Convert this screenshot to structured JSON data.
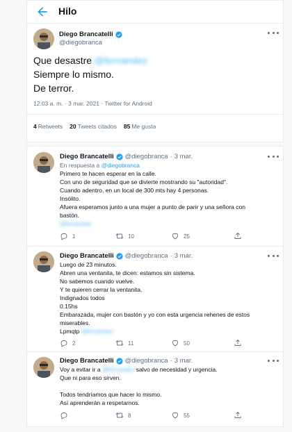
{
  "header": {
    "title": "Hilo"
  },
  "main_tweet": {
    "author_name": "Diego Brancatelli",
    "author_handle": "@diegobranca",
    "line1_prefix": "Que desastre",
    "line1_blurred": "@fernandez",
    "line2": "Siempre lo mismo.",
    "line3": "De terror.",
    "meta": "12:03 a. m. · 3 mar. 2021 · Twitter for Android",
    "stats": {
      "retweets_count": "4",
      "retweets_label": "Retweets",
      "quotes_count": "20",
      "quotes_label": "Tweets citados",
      "likes_count": "85",
      "likes_label": "Me gusta"
    }
  },
  "replies": [
    {
      "author_name": "Diego Brancatelli",
      "author_handle": "@diegobranca",
      "date": "3 mar.",
      "reply_prefix": "En respuesta a",
      "reply_mention": "@diegobranca",
      "lines": [
        "Primero te hacen esperar en la calle.",
        "Con uno de seguridad que se divierte mostrando su \"autoridad\".",
        "Cuando adentro, en un local de 300 mts hay 4 personas.",
        "Insólito.",
        "Afuera esperamos junto a una mujer a punto de parir y una señora con",
        "bastón."
      ],
      "blurred_tail": "@fernandez",
      "replies_count": "1",
      "retweets_count": "10",
      "likes_count": "25"
    },
    {
      "author_name": "Diego Brancatelli",
      "author_handle": "@diegobranca",
      "date": "3 mar.",
      "lines": [
        "Luego de 23 minutos.",
        "Abren una ventanita, te dicen: estamos sin sistema.",
        "No sabemos cuando vuelve.",
        "Y te quieren cerrar la  ventanita.",
        "Indignados todos",
        "0.15hs",
        "Embarazada, mujer con bastón y yo con esta urgencia rehenes de estos",
        "miserables."
      ],
      "last_prefix": "Lpmqtp",
      "last_blurred": "@fernandez",
      "replies_count": "2",
      "retweets_count": "11",
      "likes_count": "50"
    },
    {
      "author_name": "Diego Brancatelli",
      "author_handle": "@diegobranca",
      "date": "3 mar.",
      "first_prefix": "Voy a evitar ir a",
      "first_blurred": "@fernandez",
      "first_suffix": "salvo de necesidad y urgencia.",
      "lines": [
        "Que ni para eso sirven.",
        "",
        "Todos tendríamos que hacer lo mismo.",
        "Así aprenderán a respetarnos."
      ],
      "retweets_count": "8",
      "likes_count": "55"
    }
  ],
  "colors": {
    "accent": "#1da1f2",
    "muted": "#5b7083",
    "text": "#0f1419",
    "border": "#e6ecf0"
  }
}
